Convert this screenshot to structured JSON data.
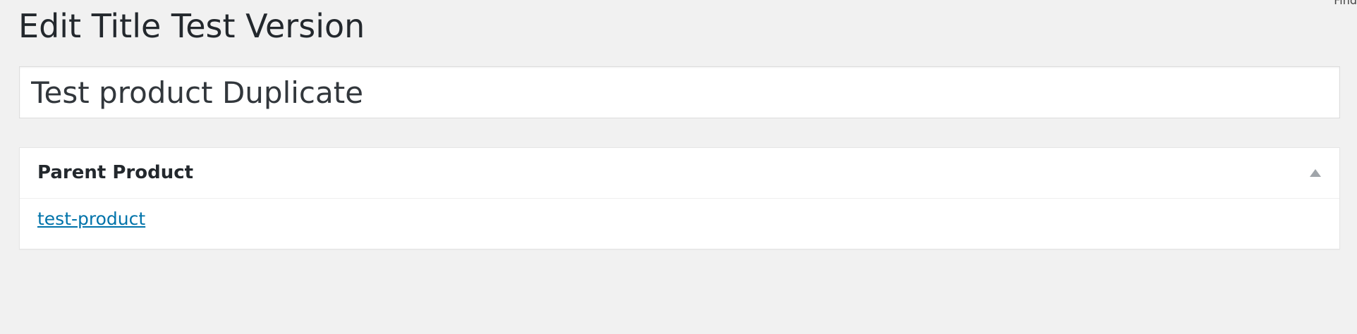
{
  "corner": {
    "text": "Find"
  },
  "page": {
    "title": "Edit Title Test Version"
  },
  "title_field": {
    "value": "Test product Duplicate"
  },
  "metabox": {
    "title": "Parent Product",
    "toggle_icon": "triangle-up-icon",
    "link_text": "test-product"
  },
  "colors": {
    "background": "#f1f1f1",
    "link": "#0073aa",
    "text": "#23282d"
  }
}
